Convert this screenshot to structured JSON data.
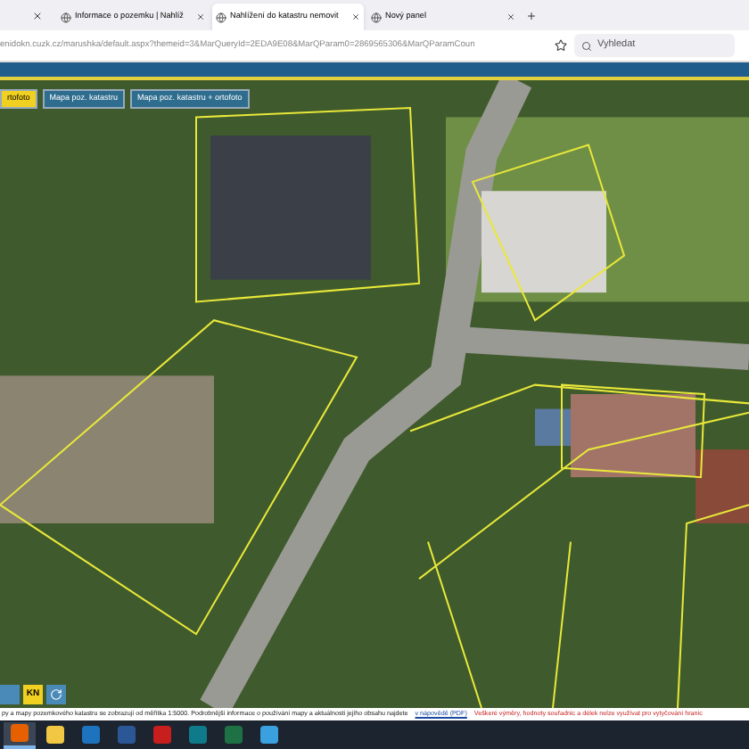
{
  "tabs": [
    {
      "label": "Informace o pozemku | Nahlíž",
      "selected": false
    },
    {
      "label": "Nahlížení do katastru nemovit",
      "selected": true
    },
    {
      "label": "Nový panel",
      "selected": false
    }
  ],
  "address_bar": {
    "value": "enidokn.cuzk.cz/marushka/default.aspx?themeid=3&MarQueryId=2EDA9E08&MarQParam0=2869565306&MarQParamCoun"
  },
  "search": {
    "placeholder": "Vyhledat"
  },
  "map_layers": [
    {
      "label": "rtofoto",
      "selected": true
    },
    {
      "label": "Mapa poz. katastru",
      "selected": false
    },
    {
      "label": "Mapa poz. katastru + ortofoto",
      "selected": false
    }
  ],
  "map_tools": [
    {
      "kind": "text",
      "label": "KN"
    },
    {
      "kind": "icon"
    }
  ],
  "status_bar": {
    "info": "py a mapy pozemkového katastru se zobrazují od měřítka 1:5000. Podrobnější informace o používání mapy a aktuálnosti jejího obsahu najdete",
    "link": "v nápovědě (PDF)",
    "warning": "Veškeré výměry, hodnoty souřadnic a délek nelze využívat pro vytyčování hranic"
  },
  "taskbar": [
    {
      "kind": "browser",
      "selected": true
    },
    {
      "kind": "folder",
      "selected": false
    },
    {
      "kind": "outlook",
      "selected": false
    },
    {
      "kind": "word",
      "selected": false
    },
    {
      "kind": "pdf",
      "selected": false
    },
    {
      "kind": "publisher",
      "selected": false
    },
    {
      "kind": "excel",
      "selected": false
    },
    {
      "kind": "photos",
      "selected": false
    }
  ]
}
